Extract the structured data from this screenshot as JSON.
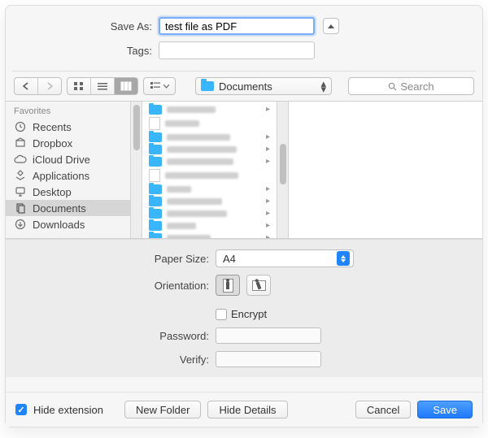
{
  "top": {
    "saveAsLabel": "Save As:",
    "saveAsValue": "test file as PDF",
    "tagsLabel": "Tags:",
    "tagsValue": ""
  },
  "toolbar": {
    "pathLabel": "Documents",
    "searchPlaceholder": "Search"
  },
  "sidebar": {
    "header": "Favorites",
    "items": [
      {
        "label": "Recents",
        "icon": "clock-icon"
      },
      {
        "label": "Dropbox",
        "icon": "box-icon"
      },
      {
        "label": "iCloud Drive",
        "icon": "cloud-icon"
      },
      {
        "label": "Applications",
        "icon": "apps-icon"
      },
      {
        "label": "Desktop",
        "icon": "desktop-icon"
      },
      {
        "label": "Documents",
        "icon": "documents-icon",
        "selected": true
      },
      {
        "label": "Downloads",
        "icon": "downloads-icon"
      }
    ]
  },
  "options": {
    "paperSizeLabel": "Paper Size:",
    "paperSizeValue": "A4",
    "orientationLabel": "Orientation:",
    "encryptLabel": "Encrypt",
    "passwordLabel": "Password:",
    "verifyLabel": "Verify:"
  },
  "bottom": {
    "hideExtensionLabel": "Hide extension",
    "hideExtensionChecked": true,
    "newFolderLabel": "New Folder",
    "hideDetailsLabel": "Hide Details",
    "cancelLabel": "Cancel",
    "saveLabel": "Save"
  }
}
